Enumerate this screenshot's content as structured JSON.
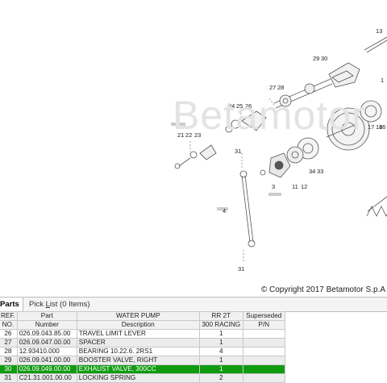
{
  "watermark": "Betamotor",
  "copyright": "© Copyright 2017 Betamotor S.p.A",
  "callouts": [
    "13",
    "29",
    "30",
    "1",
    "27",
    "28",
    "24",
    "25",
    "26",
    "18",
    "17",
    "16",
    "21",
    "22",
    "23",
    "31",
    "3",
    "34",
    "33",
    "11",
    "12",
    "4",
    "31"
  ],
  "tabs": {
    "parts_list": "Parts List",
    "pick_list_prefix": "Pick ",
    "pick_list_u": "L",
    "pick_list_suffix": "ist (0 Items)"
  },
  "table": {
    "header_row1": [
      "REF.",
      "Part",
      "WATER PUMP",
      "RR 2T",
      "Superseded"
    ],
    "header_row2": [
      "NO.",
      "Number",
      "Description",
      "300 RACING",
      "P/N"
    ],
    "rows": [
      {
        "ref": "26",
        "part": "026.09.043.85.00",
        "desc": "TRAVEL LIMIT LEVER",
        "qty": "1",
        "sup": ""
      },
      {
        "ref": "27",
        "part": "026.09.047.00.00",
        "desc": "SPACER",
        "qty": "1",
        "sup": ""
      },
      {
        "ref": "28",
        "part": "12.93410.000",
        "desc": "BEARING 10.22.6. 2RS1",
        "qty": "4",
        "sup": ""
      },
      {
        "ref": "29",
        "part": "026.09.041.00.00",
        "desc": "BOOSTER VALVE, RIGHT",
        "qty": "1",
        "sup": ""
      },
      {
        "ref": "30",
        "part": "026.09.049.00.00",
        "desc": "EXHAUST VALVE, 300CC",
        "qty": "1",
        "sup": ""
      },
      {
        "ref": "31",
        "part": "C21.31.001.00.00",
        "desc": "LOCKING SPRING",
        "qty": "2",
        "sup": ""
      }
    ],
    "selected_row": 4
  }
}
